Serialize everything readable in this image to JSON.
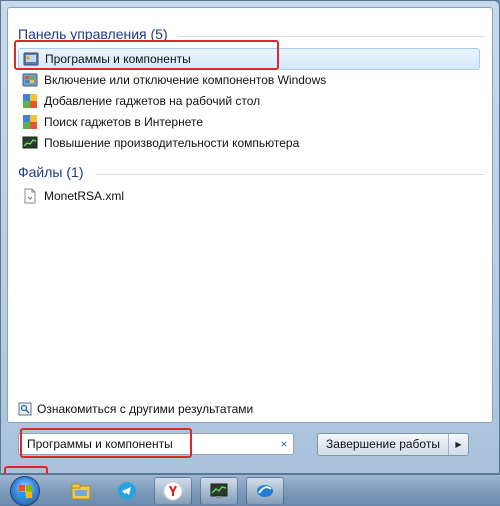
{
  "results": {
    "control_panel": {
      "header": "Панель управления (5)",
      "items": [
        {
          "label": "Программы и компоненты",
          "icon": "programs-features-icon"
        },
        {
          "label": "Включение или отключение компонентов Windows",
          "icon": "windows-features-icon"
        },
        {
          "label": "Добавление гаджетов на рабочий стол",
          "icon": "gadgets-add-icon"
        },
        {
          "label": "Поиск гаджетов в Интернете",
          "icon": "gadgets-search-icon"
        },
        {
          "label": "Повышение производительности компьютера",
          "icon": "performance-icon"
        }
      ]
    },
    "files": {
      "header": "Файлы (1)",
      "items": [
        {
          "label": "MonetRSA.xml",
          "icon": "xml-file-icon"
        }
      ]
    }
  },
  "see_more": {
    "label": "Ознакомиться с другими результатами"
  },
  "search": {
    "value": "Программы и компоненты",
    "clear_icon": "×"
  },
  "shutdown": {
    "label": "Завершение работы",
    "arrow": "▶"
  },
  "taskbar": {
    "pinned": [
      "explorer-icon",
      "telegram-icon",
      "yandex-browser-icon",
      "task-manager-icon",
      "app-icon"
    ]
  },
  "colors": {
    "header": "#1e3a8a",
    "highlight": "#e0262b"
  }
}
